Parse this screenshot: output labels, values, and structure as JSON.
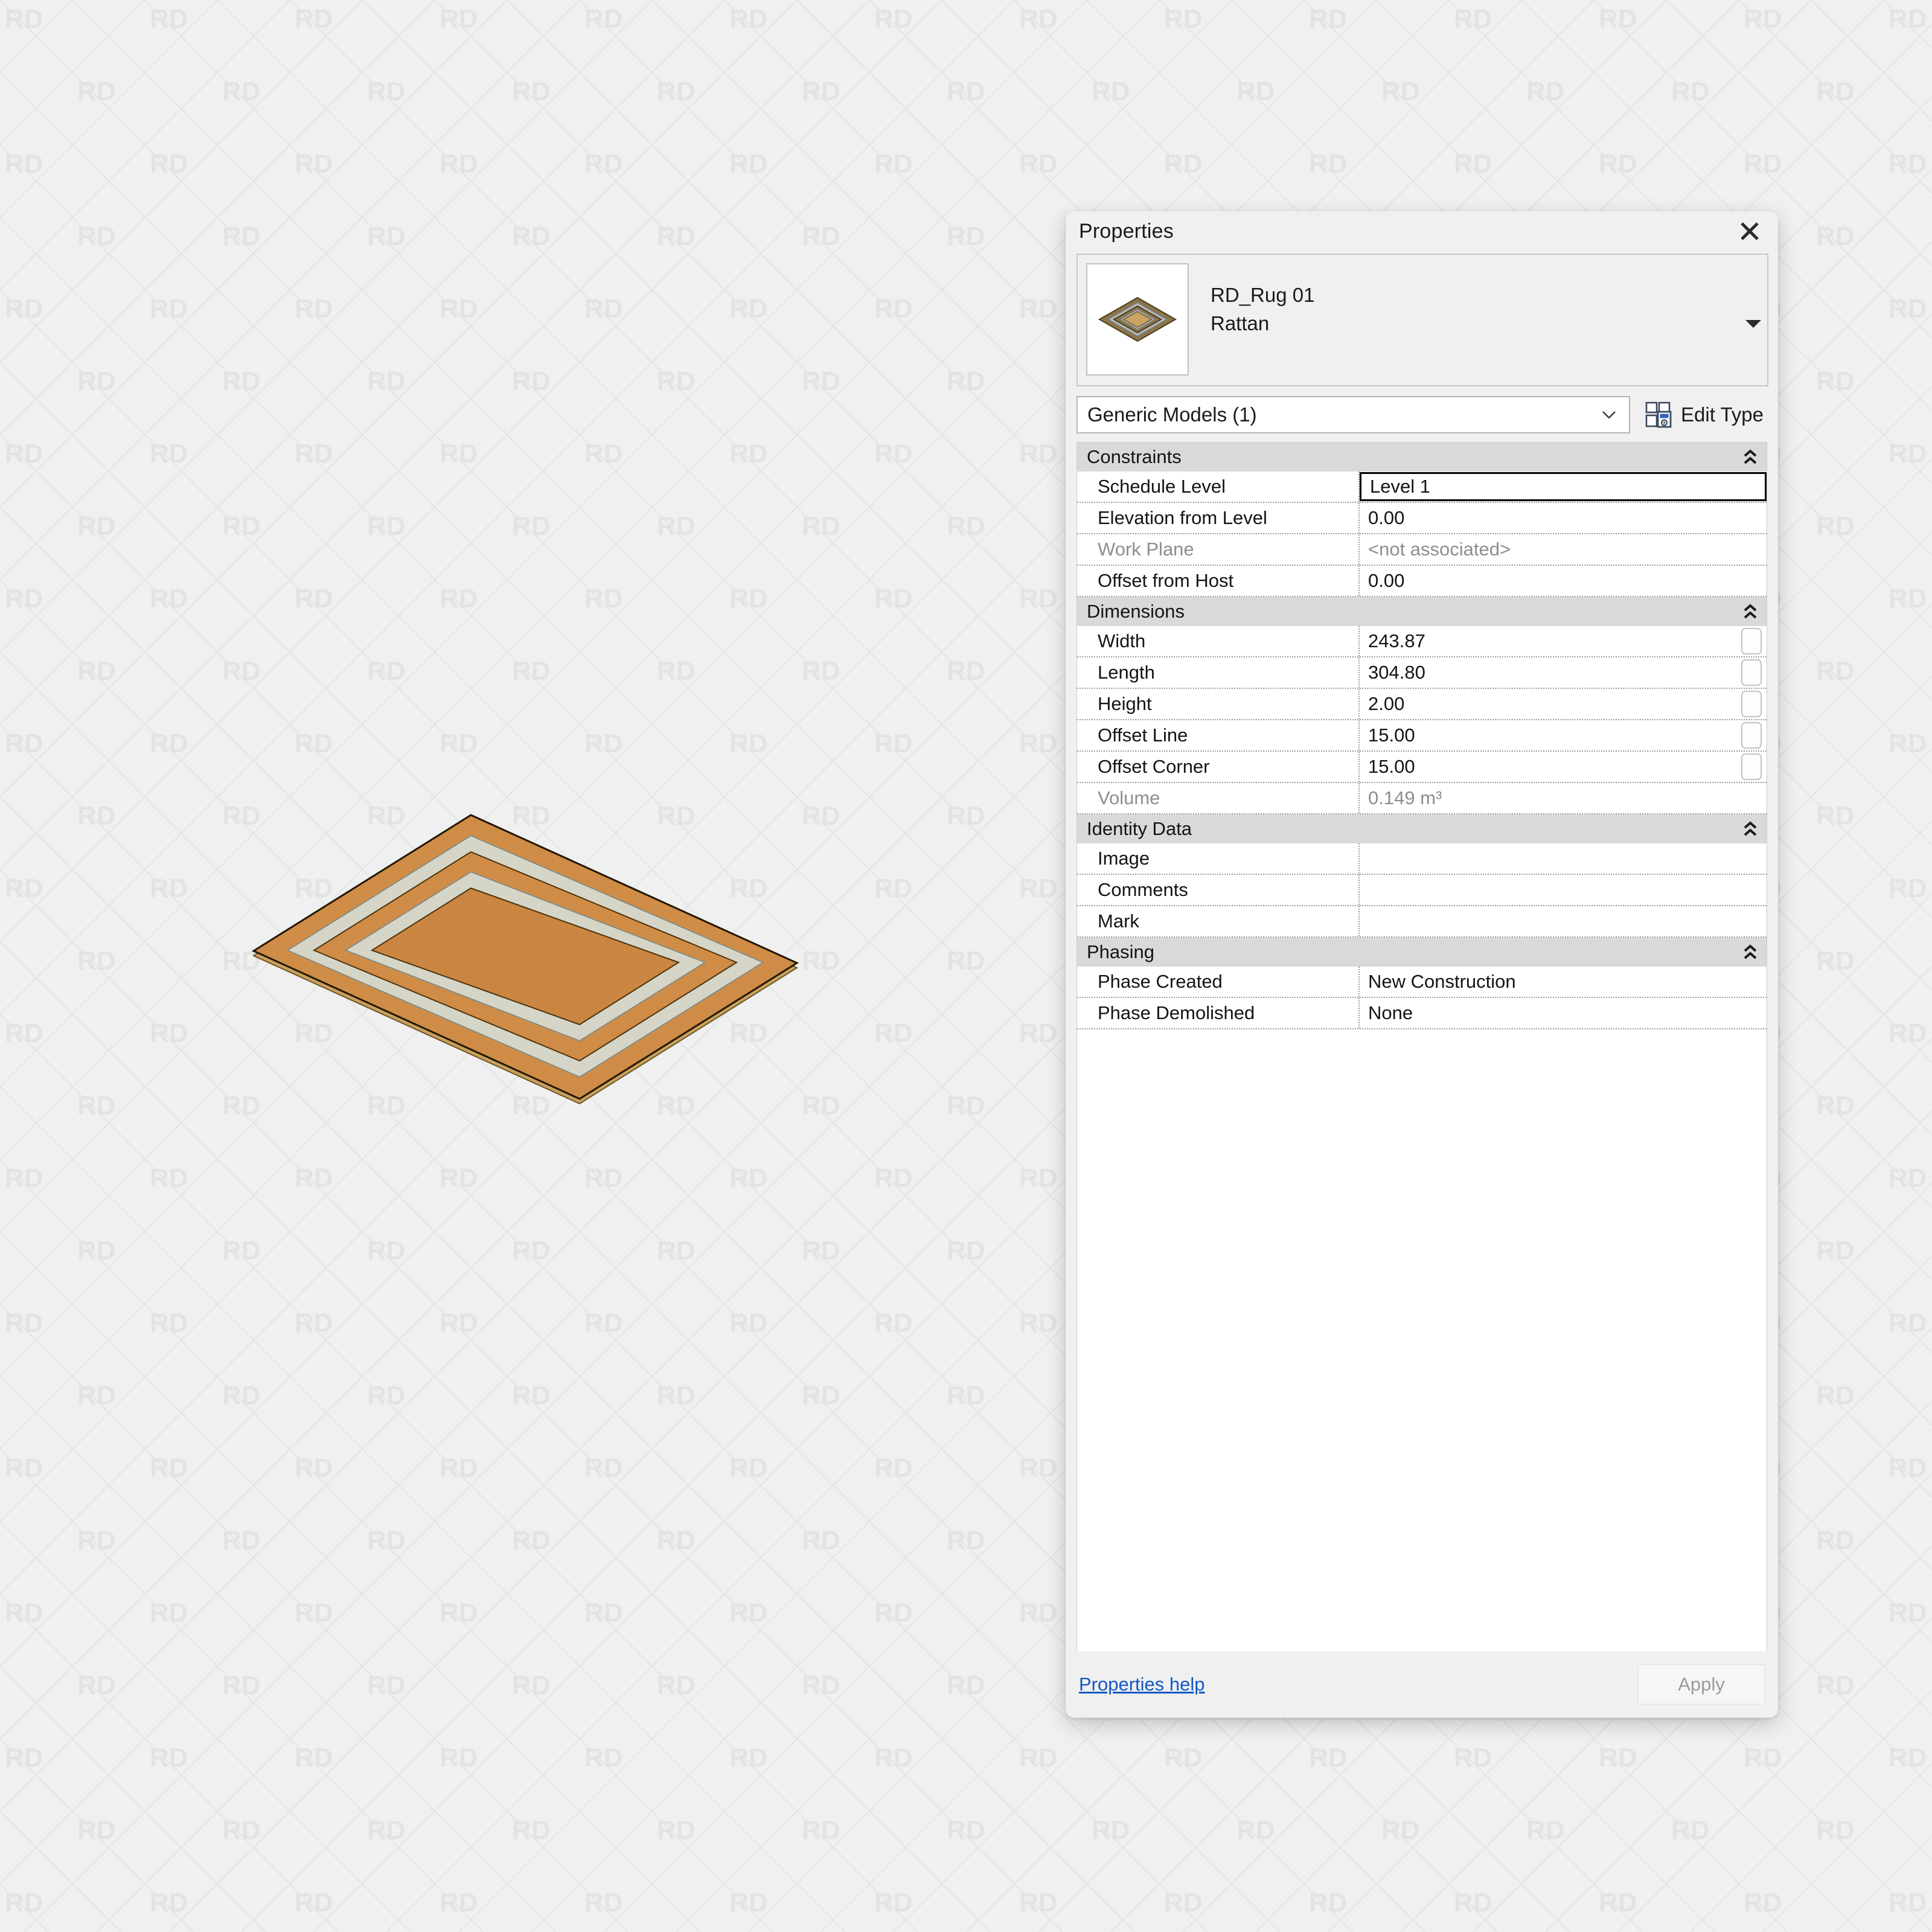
{
  "viewport": {
    "background_color": "#f0f0f0",
    "watermark_text": "RD",
    "watermark_color": "#e2e2e2"
  },
  "model": {
    "name": "RD_Rug 01",
    "colors": {
      "rattan": "#e9be84",
      "cream": "#ebebe3",
      "outline": "#5c4a22",
      "edge": "#c39a55"
    }
  },
  "panel": {
    "title": "Properties",
    "close_icon": "close-icon",
    "type_header": {
      "family_name": "RD_Rug 01",
      "type_name": "Rattan",
      "thumbnail_icon": "rug-thumbnail"
    },
    "selector": {
      "value": "Generic Models (1)",
      "caret_icon": "chevron-down-icon",
      "edit_type_label": "Edit Type",
      "edit_type_icon": "edit-type-icon"
    },
    "sections": [
      {
        "title": "Constraints",
        "collapse_icon": "double-chevron-up-icon",
        "rows": [
          {
            "label": "Schedule Level",
            "value": "Level 1",
            "readonly": false,
            "focused": true,
            "assoc": false
          },
          {
            "label": "Elevation from Level",
            "value": "0.00",
            "readonly": false,
            "focused": false,
            "assoc": false
          },
          {
            "label": "Work Plane",
            "value": "<not associated>",
            "readonly": true,
            "focused": false,
            "assoc": false
          },
          {
            "label": "Offset from Host",
            "value": "0.00",
            "readonly": false,
            "focused": false,
            "assoc": false
          }
        ]
      },
      {
        "title": "Dimensions",
        "collapse_icon": "double-chevron-up-icon",
        "rows": [
          {
            "label": "Width",
            "value": "243.87",
            "readonly": false,
            "focused": false,
            "assoc": true
          },
          {
            "label": "Length",
            "value": "304.80",
            "readonly": false,
            "focused": false,
            "assoc": true
          },
          {
            "label": "Height",
            "value": "2.00",
            "readonly": false,
            "focused": false,
            "assoc": true
          },
          {
            "label": "Offset Line",
            "value": "15.00",
            "readonly": false,
            "focused": false,
            "assoc": true
          },
          {
            "label": "Offset Corner",
            "value": "15.00",
            "readonly": false,
            "focused": false,
            "assoc": true
          },
          {
            "label": "Volume",
            "value": "0.149 m³",
            "readonly": true,
            "focused": false,
            "assoc": false
          }
        ]
      },
      {
        "title": "Identity Data",
        "collapse_icon": "double-chevron-up-icon",
        "rows": [
          {
            "label": "Image",
            "value": "",
            "readonly": false,
            "focused": false,
            "assoc": false
          },
          {
            "label": "Comments",
            "value": "",
            "readonly": false,
            "focused": false,
            "assoc": false
          },
          {
            "label": "Mark",
            "value": "",
            "readonly": false,
            "focused": false,
            "assoc": false
          }
        ]
      },
      {
        "title": "Phasing",
        "collapse_icon": "double-chevron-up-icon",
        "rows": [
          {
            "label": "Phase Created",
            "value": "New Construction",
            "readonly": false,
            "focused": false,
            "assoc": false
          },
          {
            "label": "Phase Demolished",
            "value": "None",
            "readonly": false,
            "focused": false,
            "assoc": false
          }
        ]
      }
    ],
    "footer": {
      "help_label": "Properties help",
      "apply_label": "Apply",
      "apply_enabled": false
    }
  }
}
